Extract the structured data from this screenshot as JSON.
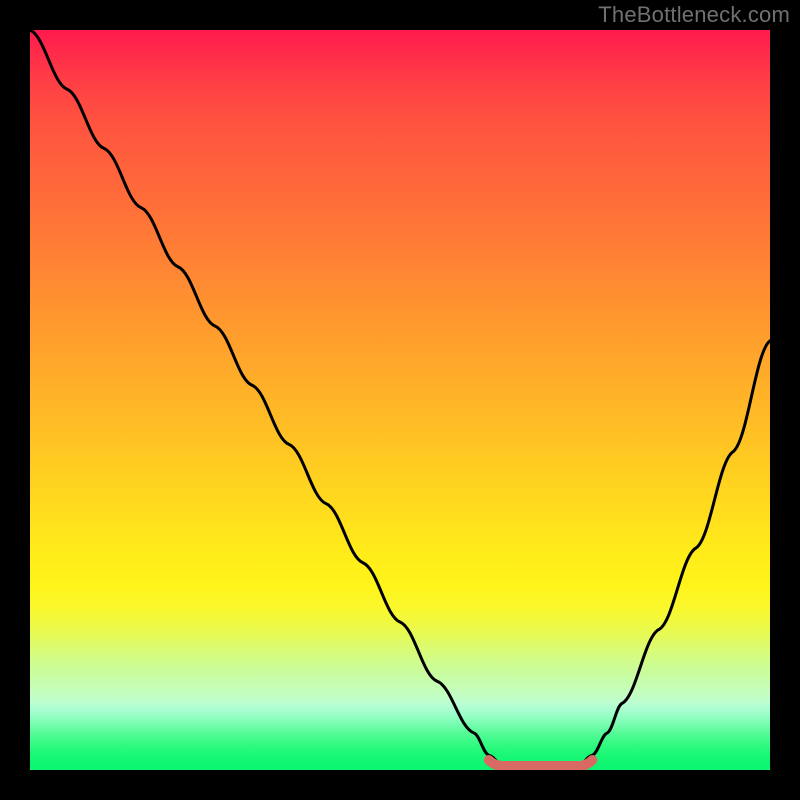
{
  "watermark": "TheBottleneck.com",
  "colors": {
    "frame": "#000000",
    "curve": "#000000",
    "marker": "#d96a63",
    "gradient_top": "#ff1a4d",
    "gradient_mid": "#ffea1a",
    "gradient_bottom": "#0af670"
  },
  "chart_data": {
    "type": "line",
    "title": "",
    "xlabel": "",
    "ylabel": "",
    "xlim": [
      0,
      100
    ],
    "ylim": [
      0,
      100
    ],
    "x": [
      0,
      5,
      10,
      15,
      20,
      25,
      30,
      35,
      40,
      45,
      50,
      55,
      60,
      62,
      64,
      66,
      68,
      70,
      72,
      74,
      76,
      78,
      80,
      85,
      90,
      95,
      100
    ],
    "y": [
      100,
      92,
      84,
      76,
      68,
      60,
      52,
      44,
      36,
      28,
      20,
      12,
      5,
      2,
      0.5,
      0,
      0,
      0,
      0,
      0.5,
      2,
      5,
      9,
      19,
      30,
      43,
      58
    ],
    "optimal_segment": {
      "x_start": 62,
      "x_end": 76,
      "y": 0
    },
    "grid": false,
    "legend": false
  }
}
